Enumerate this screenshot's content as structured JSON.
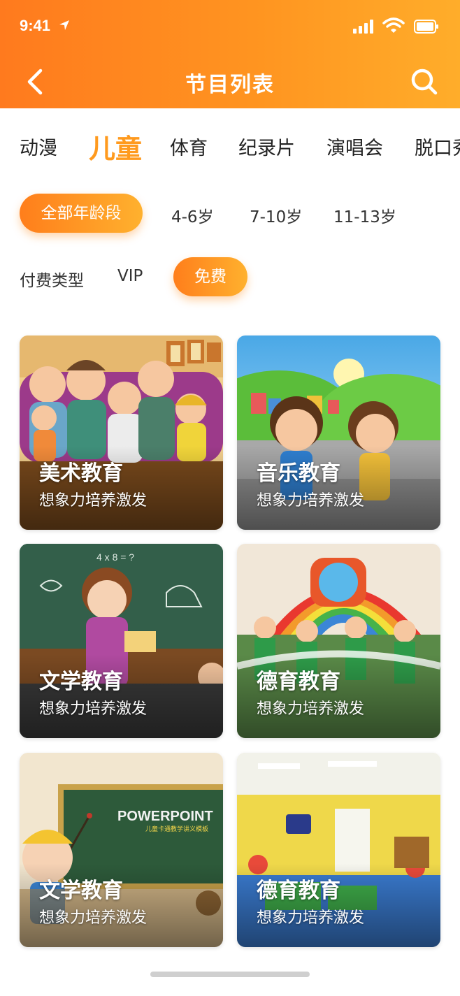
{
  "status_bar": {
    "time": "9:41"
  },
  "header": {
    "title": "节目列表",
    "back_icon": "chevron-left-icon",
    "search_icon": "search-icon"
  },
  "categories": {
    "items": [
      "动漫",
      "儿童",
      "体育",
      "纪录片",
      "演唱会",
      "脱口秀"
    ],
    "active": "儿童"
  },
  "age_filter": {
    "options": [
      "全部年龄段",
      "4-6岁",
      "7-10岁",
      "11-13岁"
    ],
    "selected": "全部年龄段"
  },
  "pay_filter": {
    "label": "付费类型",
    "options": [
      "VIP",
      "免费"
    ],
    "selected": "免费"
  },
  "cards": [
    {
      "title": "美术教育",
      "subtitle": "想象力培养激发"
    },
    {
      "title": "音乐教育",
      "subtitle": "想象力培养激发"
    },
    {
      "title": "文学教育",
      "subtitle": "想象力培养激发"
    },
    {
      "title": "德育教育",
      "subtitle": "想象力培养激发"
    },
    {
      "title": "文学教育",
      "subtitle": "想象力培养激发",
      "image_text": "POWERPOINT",
      "image_subtext": "儿童卡通教学讲义模板"
    },
    {
      "title": "德育教育",
      "subtitle": "想象力培养激发"
    }
  ],
  "colors": {
    "accent": "#ff9a1e",
    "header_start": "#ff7a1e",
    "header_end": "#ffad2a"
  }
}
